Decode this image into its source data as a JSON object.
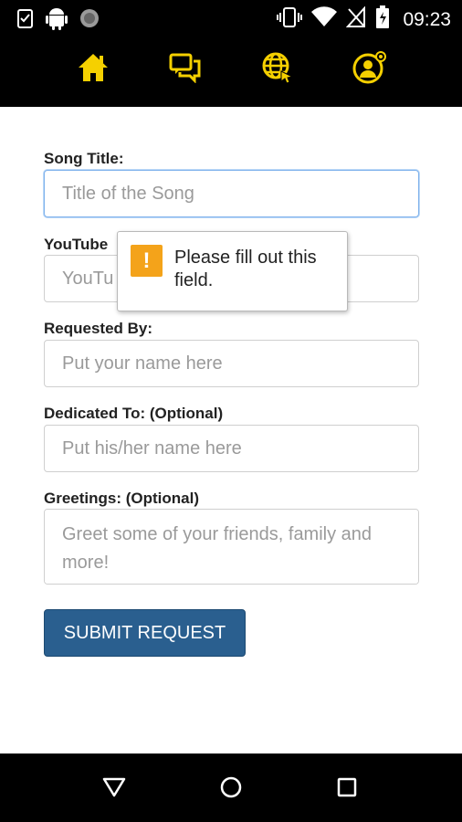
{
  "status_bar": {
    "time": "09:23",
    "left_icons": [
      "clipboard-check-icon",
      "android-icon",
      "circle-icon"
    ],
    "right_icons": [
      "vibrate-icon",
      "wifi-icon",
      "no-sim-icon",
      "battery-icon"
    ]
  },
  "nav": {
    "items": [
      {
        "icon": "home-icon",
        "label": "Home"
      },
      {
        "icon": "chat-icon",
        "label": "Chat"
      },
      {
        "icon": "globe-icon",
        "label": "Web"
      },
      {
        "icon": "profile-icon",
        "label": "Profile"
      }
    ],
    "accent": "#f5d000"
  },
  "form": {
    "song_title": {
      "label": "Song Title:",
      "placeholder": "Title of the Song"
    },
    "youtube": {
      "label": "YouTube",
      "placeholder": "YouTu"
    },
    "requested_by": {
      "label": "Requested By:",
      "placeholder": "Put your name here"
    },
    "dedicated_to": {
      "label": "Dedicated To: (Optional)",
      "placeholder": "Put his/her name here"
    },
    "greetings": {
      "label": "Greetings: (Optional)",
      "placeholder": "Greet some of your friends, family and more!"
    },
    "submit_label": "SUBMIT REQUEST"
  },
  "tooltip": {
    "icon_glyph": "!",
    "message": "Please fill out this field."
  },
  "colors": {
    "bar_bg": "#000000",
    "button": "#2a5f8f",
    "warning": "#f4a31a"
  }
}
